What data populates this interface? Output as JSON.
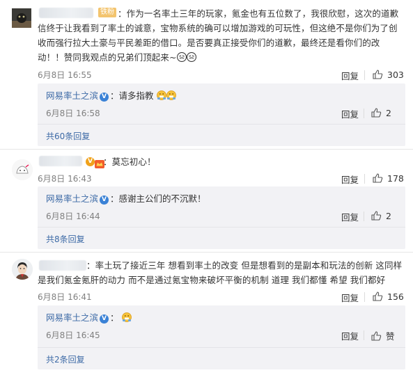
{
  "comments": [
    {
      "badge": "铁粉",
      "text": "：作为一名率土三年的玩家，氪金也有五位数了，我很欣慰，这次的道歉信终于让我看到了率土的诚意，宝物系统的确可以增加游戏的可玩性，但这绝不是你们为了创收而强行拉大土豪与平民差距的借口。是否要真正接受你们的道歉，最终还是看你们的改动！！赞同我观点的兄弟们顶起来~",
      "time": "6月8日 16:55",
      "reply_label": "回复",
      "likes": "303",
      "reply": {
        "author": "网易率土之滨",
        "text": "：请多指教",
        "time": "6月8日 16:58",
        "reply_label": "回复",
        "likes": "2"
      },
      "more": "共60条回复"
    },
    {
      "text": "：莫忘初心！",
      "time": "6月8日 16:43",
      "reply_label": "回复",
      "likes": "178",
      "reply": {
        "author": "网易率土之滨",
        "text": "：感谢主公们的不沉默！",
        "time": "6月8日 16:44",
        "reply_label": "回复",
        "likes": "2"
      },
      "more": "共8条回复"
    },
    {
      "text": "：率土玩了接近三年 想看到率土的改变 但是想看到的是副本和玩法的创新 这同样是我们氪金氪肝的动力 而不是通过氪宝物来破坏平衡的机制 道理 我们都懂 希望 我们都好",
      "time": "6月8日 16:41",
      "reply_label": "回复",
      "likes": "156",
      "reply": {
        "author": "网易率土之滨",
        "text": "：",
        "time": "6月8日 16:45",
        "reply_label": "回复",
        "likes": "赞"
      },
      "more": "共2条回复"
    }
  ],
  "colors": {
    "link": "#3d6aa6",
    "badge": "#f3c46e",
    "reply_bg": "#f2f2f5"
  }
}
